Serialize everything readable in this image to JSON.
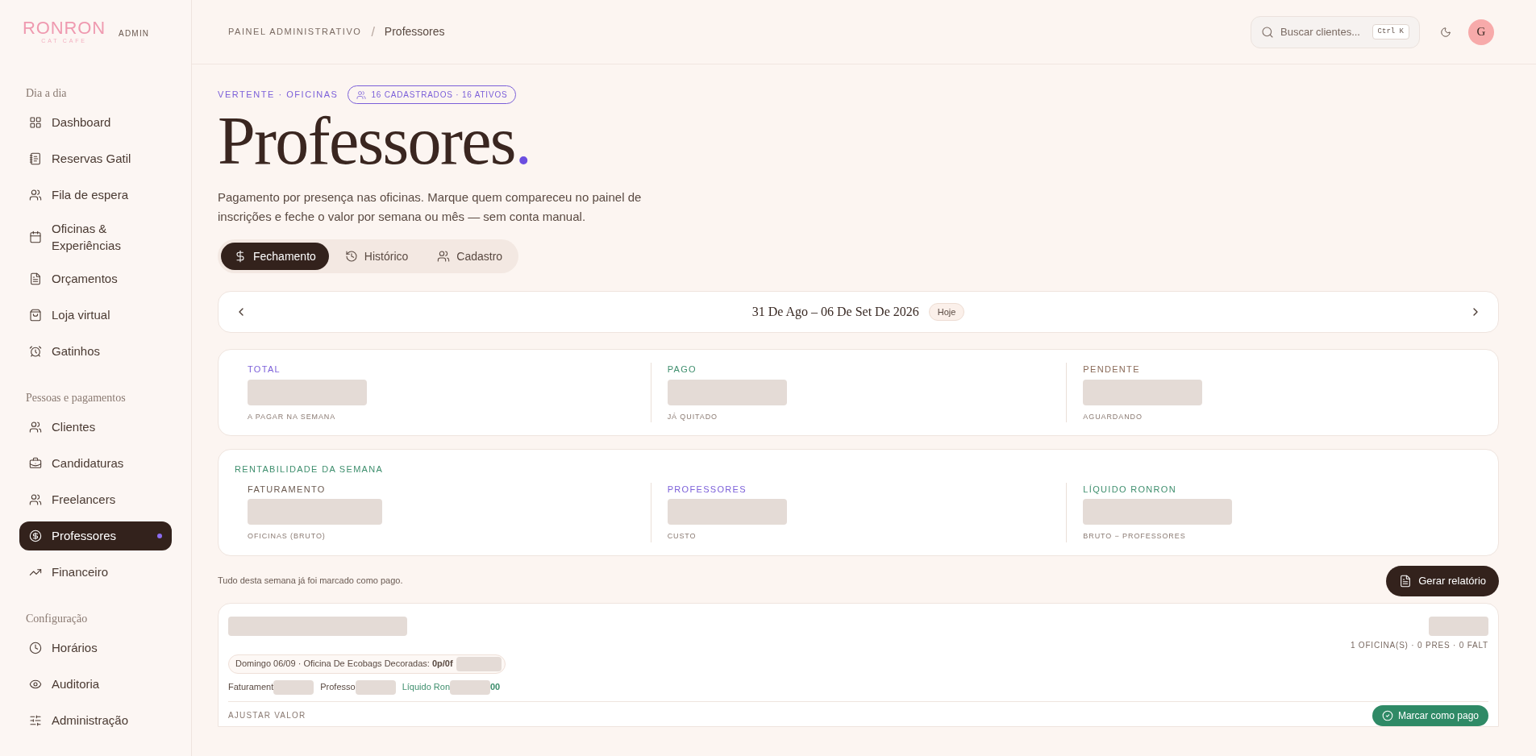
{
  "brand": {
    "name": "RONRON",
    "sub": "CAT CAFE",
    "tag": "ADMIN"
  },
  "sidebar": {
    "sections": [
      {
        "title": "Dia a dia",
        "items": [
          {
            "label": "Dashboard",
            "selected": false
          },
          {
            "label": "Reservas Gatil",
            "selected": false
          },
          {
            "label": "Fila de espera",
            "selected": false
          },
          {
            "label": "Oficinas & Experiências",
            "selected": false
          },
          {
            "label": "Orçamentos",
            "selected": false
          },
          {
            "label": "Loja virtual",
            "selected": false
          },
          {
            "label": "Gatinhos",
            "selected": false
          }
        ]
      },
      {
        "title": "Pessoas e pagamentos",
        "items": [
          {
            "label": "Clientes",
            "selected": false
          },
          {
            "label": "Candidaturas",
            "selected": false
          },
          {
            "label": "Freelancers",
            "selected": false
          },
          {
            "label": "Professores",
            "selected": true
          },
          {
            "label": "Financeiro",
            "selected": false
          }
        ]
      },
      {
        "title": "Configuração",
        "items": [
          {
            "label": "Horários",
            "selected": false
          },
          {
            "label": "Auditoria",
            "selected": false
          },
          {
            "label": "Administração",
            "selected": false
          }
        ]
      }
    ]
  },
  "header": {
    "breadcrumb": [
      "PAINEL ADMINISTRATIVO",
      "Professores"
    ],
    "breadcrumb_separator": "/",
    "search": {
      "placeholder": "Buscar clientes...",
      "shortcut": "Ctrl K"
    },
    "avatar": "G"
  },
  "page": {
    "eyebrow": "VERTENTE · OFICINAS",
    "badge": "16 CADASTRADOS · 16 ATIVOS",
    "title": "Professores",
    "title_mark": ".",
    "description": "Pagamento por presença nas oficinas. Marque quem compareceu no painel de inscrições e feche o valor por semana ou mês — sem conta manual."
  },
  "tabs": [
    {
      "label": "Fechamento",
      "selected": true
    },
    {
      "label": "Histórico",
      "selected": false
    },
    {
      "label": "Cadastro",
      "selected": false
    }
  ],
  "week": {
    "label": "31 De Ago – 06 De Set De 2026",
    "today": "Hoje"
  },
  "totals": [
    {
      "label": "TOTAL",
      "caption": "A PAGAR NA SEMANA",
      "color": "#7b5fd9"
    },
    {
      "label": "PAGO",
      "caption": "JÁ QUITADO",
      "color": "#3f8f6e"
    },
    {
      "label": "PENDENTE",
      "caption": "AGUARDANDO",
      "color": "#8a6a58"
    }
  ],
  "profit": {
    "title": "RENTABILIDADE DA SEMANA",
    "items": [
      {
        "label": "FATURAMENTO",
        "caption": "OFICINAS (BRUTO)",
        "color": "#6b5a50"
      },
      {
        "label": "PROFESSORES",
        "caption": "CUSTO",
        "color": "#7b5fd9"
      },
      {
        "label": "LÍQUIDO RONRON",
        "caption": "BRUTO − PROFESSORES",
        "color": "#3f8f6e"
      }
    ]
  },
  "note": "Tudo desta semana já foi marcado como pago.",
  "report_button": "Gerar relatório",
  "teacher": {
    "summary": "1 OFICINA(S) · 0 PRES · 0 FALT",
    "session": "Domingo 06/09 · Oficina De Ecobags Decoradas: **0p/0f**",
    "figures": [
      {
        "label": "Faturament",
        "color": "#5a4a42"
      },
      {
        "label": "Professo",
        "color": "#5a4a42"
      },
      {
        "label": "Líquido Ron",
        "tail": "00",
        "color": "#3f8f6e"
      }
    ],
    "adjust": "AJUSTAR VALOR",
    "pay_button": "Marcar como pago"
  }
}
